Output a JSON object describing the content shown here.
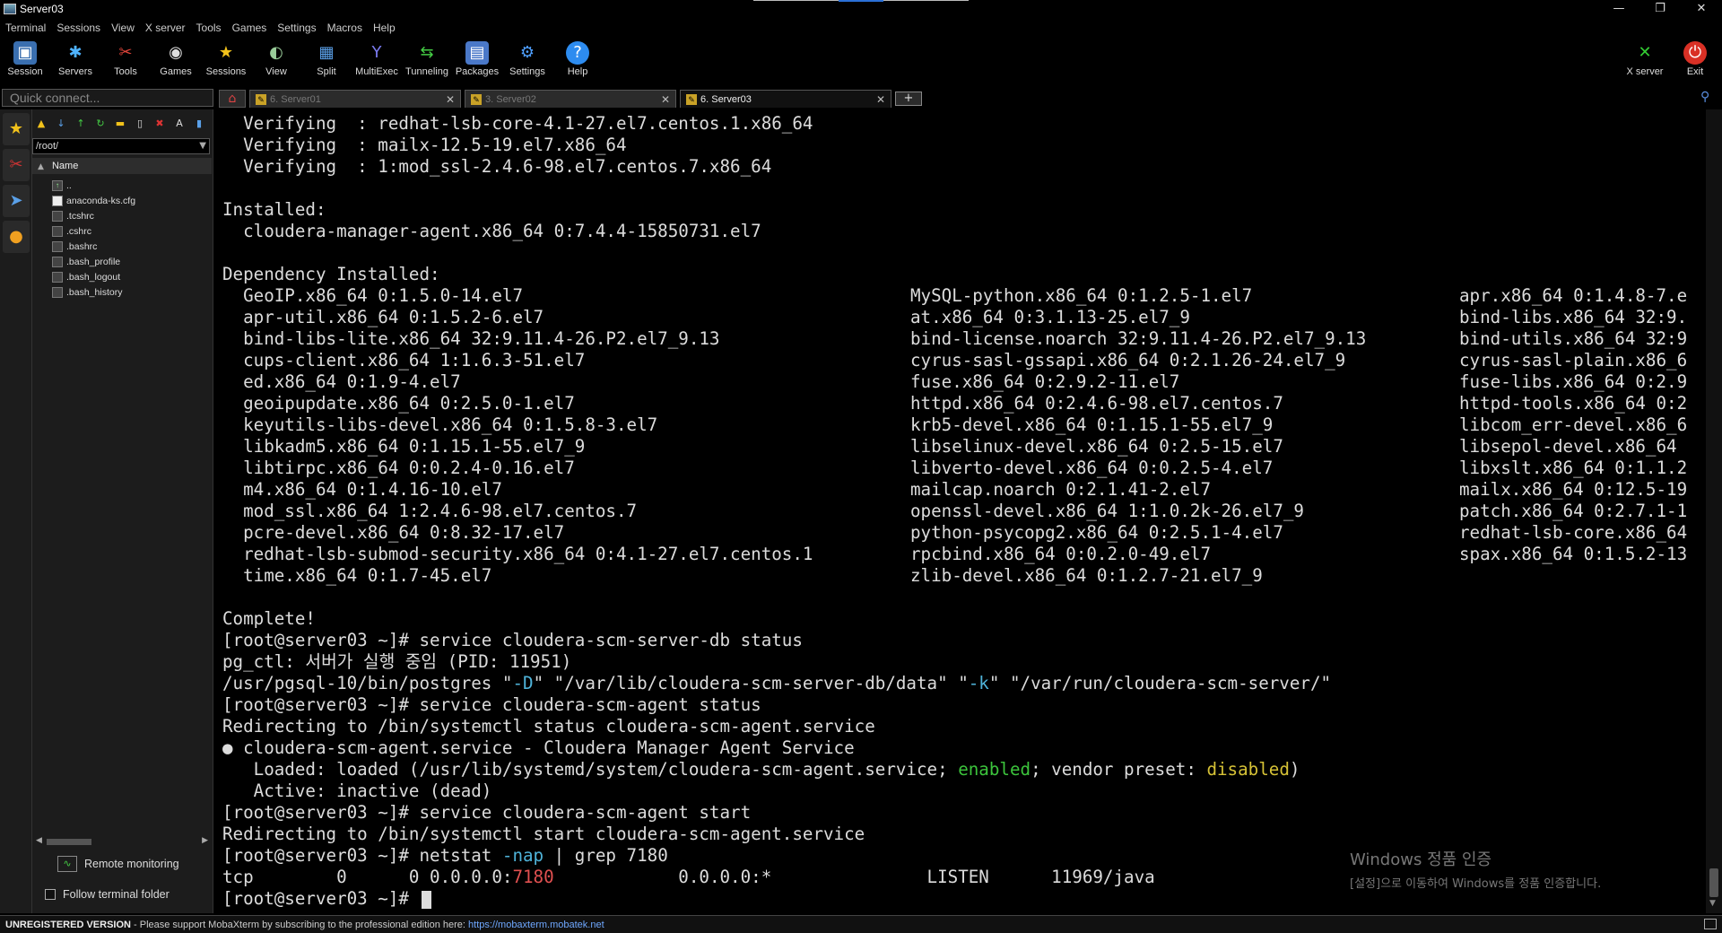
{
  "window": {
    "title": "Server03",
    "controls": [
      "—",
      "❐",
      "✕"
    ]
  },
  "menu": [
    "Terminal",
    "Sessions",
    "View",
    "X server",
    "Tools",
    "Games",
    "Settings",
    "Macros",
    "Help"
  ],
  "toolbar": {
    "session": "Session",
    "servers": "Servers",
    "tools": "Tools",
    "games": "Games",
    "sessions": "Sessions",
    "view": "View",
    "split": "Split",
    "multiexec": "MultiExec",
    "tunneling": "Tunneling",
    "packages": "Packages",
    "settings": "Settings",
    "help": "Help",
    "xserver": "X server",
    "exit": "Exit"
  },
  "quick_connect": {
    "placeholder": "Quick connect..."
  },
  "tabs": [
    {
      "label": "6. Server01",
      "close": "✕"
    },
    {
      "label": "3. Server02",
      "close": "✕"
    },
    {
      "label": "6. Server03",
      "close": "✕"
    }
  ],
  "sftp": {
    "path": "/root/",
    "column": "Name",
    "files": [
      "..",
      "anaconda-ks.cfg",
      ".tcshrc",
      ".cshrc",
      ".bashrc",
      ".bash_profile",
      ".bash_logout",
      ".bash_history"
    ],
    "remote_monitoring": "Remote monitoring",
    "follow_folder": "Follow terminal folder"
  },
  "terminal": {
    "lines": [
      "  Verifying  : redhat-lsb-core-4.1-27.el7.centos.1.x86_64",
      "  Verifying  : mailx-12.5-19.el7.x86_64",
      "  Verifying  : 1:mod_ssl-2.4.6-98.el7.centos.7.x86_64",
      "",
      "Installed:",
      "  cloudera-manager-agent.x86_64 0:7.4.4-15850731.el7",
      "",
      "Dependency Installed:"
    ],
    "deps_col1": [
      "  GeoIP.x86_64 0:1.5.0-14.el7",
      "  apr-util.x86_64 0:1.5.2-6.el7",
      "  bind-libs-lite.x86_64 32:9.11.4-26.P2.el7_9.13",
      "  cups-client.x86_64 1:1.6.3-51.el7",
      "  ed.x86_64 0:1.9-4.el7",
      "  geoipupdate.x86_64 0:2.5.0-1.el7",
      "  keyutils-libs-devel.x86_64 0:1.5.8-3.el7",
      "  libkadm5.x86_64 0:1.15.1-55.el7_9",
      "  libtirpc.x86_64 0:0.2.4-0.16.el7",
      "  m4.x86_64 0:1.4.16-10.el7",
      "  mod_ssl.x86_64 1:2.4.6-98.el7.centos.7",
      "  pcre-devel.x86_64 0:8.32-17.el7",
      "  redhat-lsb-submod-security.x86_64 0:4.1-27.el7.centos.1",
      "  time.x86_64 0:1.7-45.el7"
    ],
    "deps_col2": [
      "MySQL-python.x86_64 0:1.2.5-1.el7",
      "at.x86_64 0:3.1.13-25.el7_9",
      "bind-license.noarch 32:9.11.4-26.P2.el7_9.13",
      "cyrus-sasl-gssapi.x86_64 0:2.1.26-24.el7_9",
      "fuse.x86_64 0:2.9.2-11.el7",
      "httpd.x86_64 0:2.4.6-98.el7.centos.7",
      "krb5-devel.x86_64 0:1.15.1-55.el7_9",
      "libselinux-devel.x86_64 0:2.5-15.el7",
      "libverto-devel.x86_64 0:0.2.5-4.el7",
      "mailcap.noarch 0:2.1.41-2.el7",
      "openssl-devel.x86_64 1:1.0.2k-26.el7_9",
      "python-psycopg2.x86_64 0:2.5.1-4.el7",
      "rpcbind.x86_64 0:0.2.0-49.el7",
      "zlib-devel.x86_64 0:1.2.7-21.el7_9"
    ],
    "deps_col3": [
      "apr.x86_64 0:1.4.8-7.e",
      "bind-libs.x86_64 32:9.",
      "bind-utils.x86_64 32:9",
      "cyrus-sasl-plain.x86_6",
      "fuse-libs.x86_64 0:2.9",
      "httpd-tools.x86_64 0:2",
      "libcom_err-devel.x86_6",
      "libsepol-devel.x86_64",
      "libxslt.x86_64 0:1.1.2",
      "mailx.x86_64 0:12.5-19",
      "patch.x86_64 0:2.7.1-1",
      "redhat-lsb-core.x86_64",
      "spax.x86_64 0:1.5.2-13",
      ""
    ],
    "tail": {
      "complete": "Complete!",
      "cmd1": "[root@server03 ~]# service cloudera-scm-server-db status",
      "pgctl": "pg_ctl: 서버가 실행 중임 (PID: 11951)",
      "pg1": "/usr/pgsql-10/bin/postgres \"",
      "pgD": "-D",
      "pg2": "\" \"/var/lib/cloudera-scm-server-db/data\" \"",
      "pgK": "-k",
      "pg3": "\" \"/var/run/cloudera-scm-server/\"",
      "cmd2": "[root@server03 ~]# service cloudera-scm-agent status",
      "redir1": "Redirecting to /bin/systemctl status cloudera-scm-agent.service",
      "svc": "● cloudera-scm-agent.service - Cloudera Manager Agent Service",
      "loaded1": "   Loaded: loaded (/usr/lib/systemd/system/cloudera-scm-agent.service; ",
      "enabled": "enabled",
      "loaded2": "; vendor preset: ",
      "disabled": "disabled",
      "loaded3": ")",
      "active": "   Active: inactive (dead)",
      "cmd3": "[root@server03 ~]# service cloudera-scm-agent start",
      "redir2": "Redirecting to /bin/systemctl start cloudera-scm-agent.service",
      "cmd4a": "[root@server03 ~]# netstat ",
      "cmd4b": "-nap",
      "cmd4c": " | grep 7180",
      "tcp1": "tcp        0      0 0.0.0.0:",
      "tcpport": "7180",
      "tcp2": "            0.0.0.0:*               LISTEN      11969/java",
      "prompt": "[root@server03 ~]# "
    }
  },
  "watermark": {
    "line1": "Windows 정품 인증",
    "line2": "[설정]으로 이동하여 Windows를 정품 인증합니다."
  },
  "status": {
    "unregistered": "UNREGISTERED VERSION",
    "text": "  -  Please support MobaXterm by subscribing to the professional edition here:  ",
    "link": "https://mobaxterm.mobatek.net"
  }
}
